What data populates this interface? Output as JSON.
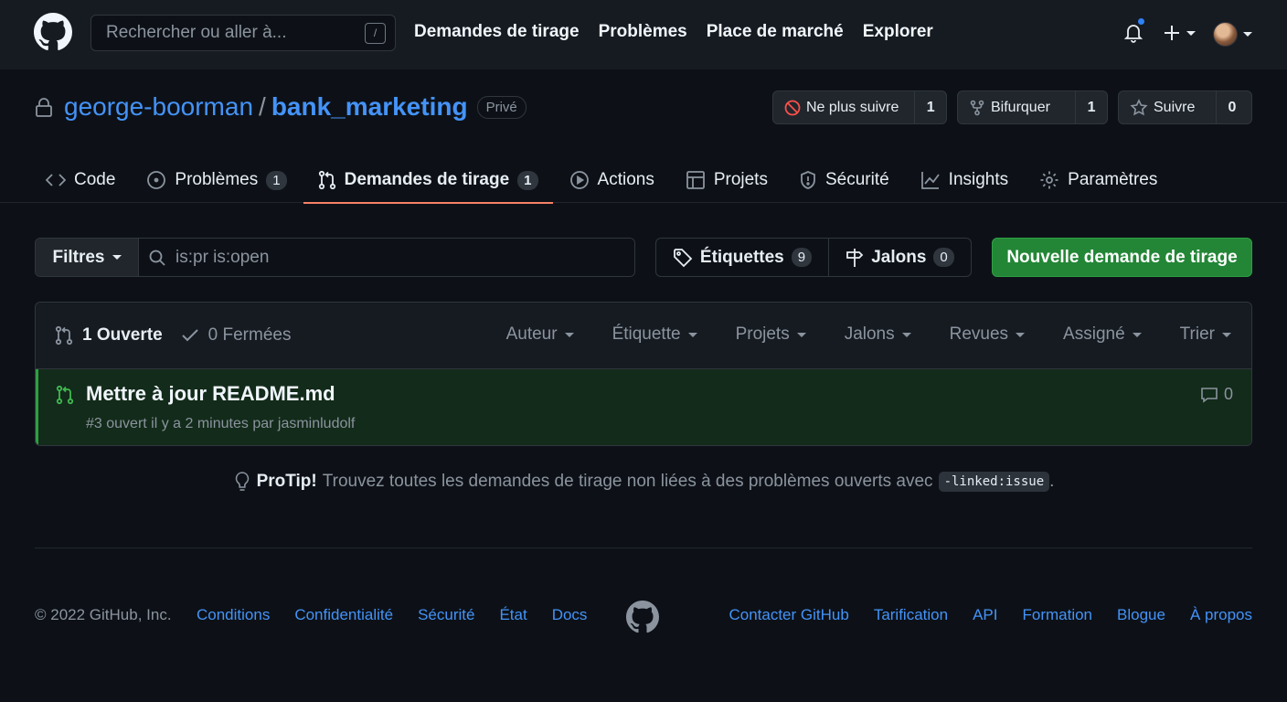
{
  "header": {
    "search_placeholder": "Rechercher ou aller à...",
    "search_shortcut": "/",
    "nav": [
      "Demandes de tirage",
      "Problèmes",
      "Place de marché",
      "Explorer"
    ]
  },
  "repo": {
    "owner": "george-boorman",
    "separator": "/",
    "name": "bank_marketing",
    "visibility": "Privé",
    "unwatch_label": "Ne plus suivre",
    "unwatch_count": "1",
    "fork_label": "Bifurquer",
    "fork_count": "1",
    "star_label": "Suivre",
    "star_count": "0"
  },
  "tabs": [
    {
      "label": "Code",
      "icon": "code-icon"
    },
    {
      "label": "Problèmes",
      "count": "1",
      "icon": "issue-icon"
    },
    {
      "label": "Demandes de tirage",
      "count": "1",
      "icon": "pull-request-icon",
      "active": true
    },
    {
      "label": "Actions",
      "icon": "play-icon"
    },
    {
      "label": "Projets",
      "icon": "table-icon"
    },
    {
      "label": "Sécurité",
      "icon": "shield-icon"
    },
    {
      "label": "Insights",
      "icon": "graph-icon"
    },
    {
      "label": "Paramètres",
      "icon": "gear-icon"
    }
  ],
  "filters": {
    "button": "Filtres",
    "query": "is:pr is:open",
    "labels": "Étiquettes",
    "labels_count": "9",
    "milestones": "Jalons",
    "milestones_count": "0",
    "new_pr": "Nouvelle demande de tirage"
  },
  "list": {
    "open_label": "1 Ouverte",
    "closed_label": "0 Fermées",
    "sorts": [
      "Auteur",
      "Étiquette",
      "Projets",
      "Jalons",
      "Revues",
      "Assigné",
      "Trier"
    ],
    "items": [
      {
        "title": "Mettre à jour README.md",
        "meta": "#3 ouvert il y a 2 minutes par jasminludolf",
        "comments": "0"
      }
    ]
  },
  "protip": {
    "lead": "ProTip!",
    "text": "Trouvez toutes les demandes de tirage non liées à des problèmes ouverts avec",
    "code": "-linked:issue",
    "end": "."
  },
  "footer": {
    "copyright": "© 2022 GitHub, Inc.",
    "left_links": [
      "Conditions",
      "Confidentialité",
      "Sécurité",
      "État",
      "Docs"
    ],
    "right_links": [
      "Contacter GitHub",
      "Tarification",
      "API",
      "Formation",
      "Blogue",
      "À propos"
    ]
  },
  "colors": {
    "background": "#0d1117",
    "header": "#161b22",
    "link": "#4493f8",
    "primary_button": "#238636",
    "active_tab_underline": "#f78166",
    "notification_dot": "#2f81f7"
  }
}
